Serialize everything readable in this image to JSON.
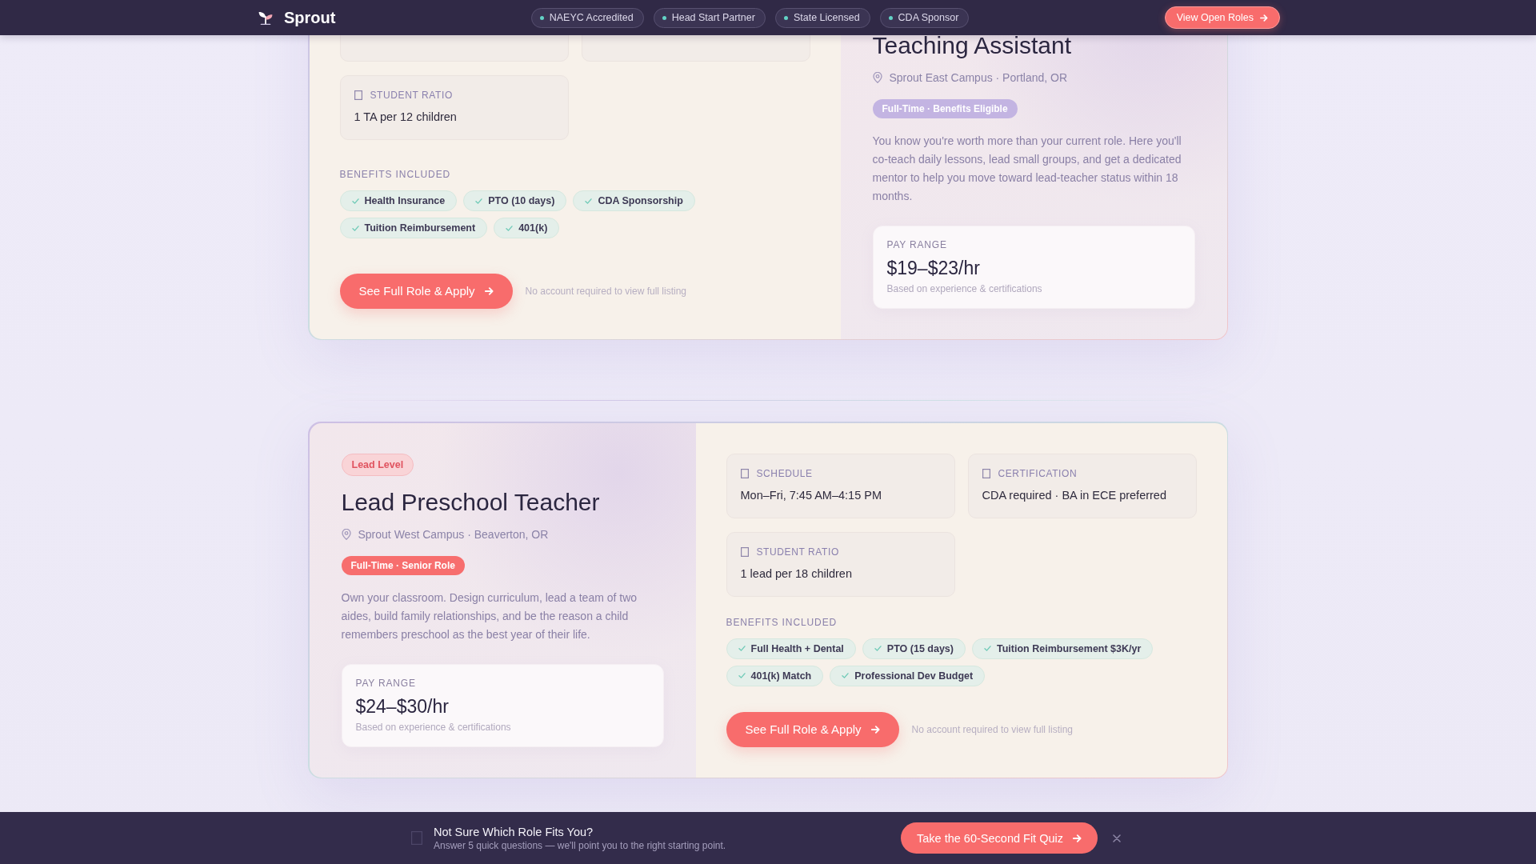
{
  "nav": {
    "brand": "Sprout",
    "badges": [
      "NAEYC Accredited",
      "Head Start Partner",
      "State Licensed",
      "CDA Sponsor"
    ],
    "button": "View Open Roles"
  },
  "roles": [
    {
      "kind": "mirrored",
      "title": "Teaching Assistant",
      "location": "Sprout East Campus · Portland, OR",
      "tag": {
        "text": "Full-Time · Benefits Eligible",
        "color": "#c3b4e2"
      },
      "description": "You know you're worth more than your current role. Here you'll co-teach daily lessons, lead small groups, and get a dedicated mentor to help you move toward lead-teacher status within 18 months.",
      "pay": {
        "label": "PAY RANGE",
        "value": "$19–$23/hr",
        "note": "Based on experience & certifications"
      },
      "facts": [
        {
          "kind": "covered"
        },
        {
          "kind": "covered"
        },
        {
          "kind": "detail",
          "label": "STUDENT RATIO",
          "value": "1 TA per 12 children"
        }
      ],
      "benefits_heading": "BENEFITS INCLUDED",
      "benefits": [
        "Health Insurance",
        "PTO (10 days)",
        "CDA Sponsorship",
        "Tuition Reimbursement",
        "401(k)"
      ],
      "button": "See Full Role & Apply",
      "button_note": "No account required to view full listing"
    },
    {
      "kind": "standard",
      "level_badge": "Lead Level",
      "title": "Lead Preschool Teacher",
      "location": "Sprout West Campus · Beaverton, OR",
      "tag": {
        "text": "Full-Time · Senior Role",
        "color": "#f76e6e"
      },
      "description": "Own your classroom. Design curriculum, lead a team of two aides, build family relationships, and be the reason a child remembers preschool as the best year of their life.",
      "pay": {
        "label": "PAY RANGE",
        "value": "$24–$30/hr",
        "note": "Based on experience & certifications"
      },
      "facts": [
        {
          "kind": "detail",
          "label": "SCHEDULE",
          "value": "Mon–Fri, 7:45 AM–4:15 PM"
        },
        {
          "kind": "detail",
          "label": "CERTIFICATION",
          "value": "CDA required · BA in ECE preferred"
        },
        {
          "kind": "detail",
          "label": "STUDENT RATIO",
          "value": "1 lead per 18 children"
        }
      ],
      "benefits_heading": "BENEFITS INCLUDED",
      "benefits": [
        "Full Health + Dental",
        "PTO (15 days)",
        "Tuition Reimbursement $3K/yr",
        "401(k) Match",
        "Professional Dev Budget"
      ],
      "button": "See Full Role & Apply",
      "button_note": "No account required to view full listing"
    }
  ],
  "quiz_banner": {
    "title": "Not Sure Which Role Fits You?",
    "subtitle": "Answer 5 quick questions — we'll point you to the right starting point.",
    "button": "Take the 60-Second Fit Quiz"
  }
}
